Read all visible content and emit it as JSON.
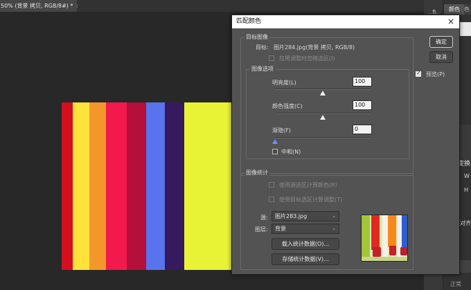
{
  "document": {
    "tab_label": "50% (背景 拷贝, RGB/8#) *",
    "close_glyph": "×"
  },
  "right_panel": {
    "tab1": "颜色",
    "tab2": "色",
    "lines": [
      "色",
      "变换",
      "W",
      "H",
      "对齐并",
      "正常"
    ]
  },
  "stripes": [
    "#d4101e",
    "#ffe23a",
    "#f4972a",
    "#f2194c",
    "#b50f3c",
    "#5873ec",
    "#371a5d",
    "#e8f336"
  ],
  "dialog": {
    "title": "匹配颜色",
    "close": "×",
    "target_group": "目标图像",
    "target_label": "目标:",
    "target_value": "图片284.jpg(背景 拷贝, RGB/8)",
    "ignore_selection": "应用调整时忽略选区(I)",
    "options_group": "图像选项",
    "luminance_label": "明亮度(L)",
    "luminance_value": "100",
    "luminance_level": 0.5,
    "intensity_label": "颜色强度(C)",
    "intensity_value": "100",
    "intensity_level": 0.5,
    "fade_label": "渐隐(F)",
    "fade_value": "0",
    "fade_level": 0,
    "neutralize": "中和(N)",
    "stats_group": "图像统计",
    "use_source_selection": "使用源选区计算颜色(R)",
    "use_target_selection": "使用目标选区计算调整(T)",
    "source_label": "源:",
    "source_value": "图片283.jpg",
    "layer_label": "图层:",
    "layer_value": "背景",
    "load_stats": "载入统计数据(O)...",
    "save_stats": "存储统计数据(V)...",
    "ok": "确定",
    "cancel": "取消",
    "preview": "预览(P)",
    "preview_checked": true,
    "chevron": "⌄"
  }
}
